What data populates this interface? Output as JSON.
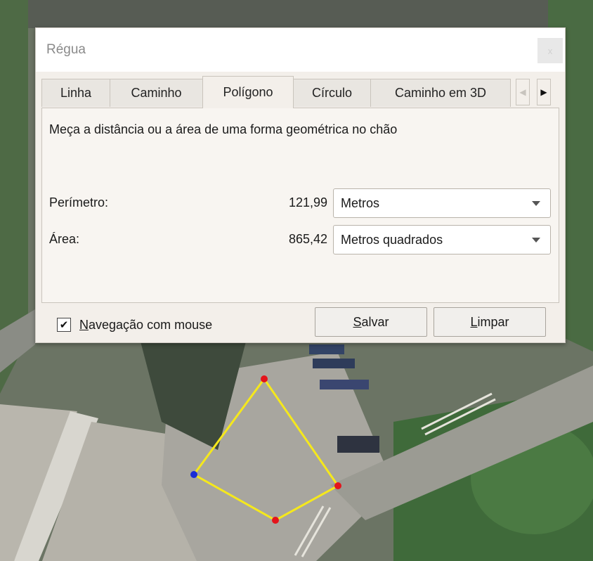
{
  "dialog": {
    "title": "Régua",
    "close_label": "x"
  },
  "tabs": [
    {
      "label": "Linha",
      "active": false
    },
    {
      "label": "Caminho",
      "active": false
    },
    {
      "label": "Polígono",
      "active": true
    },
    {
      "label": "Círculo",
      "active": false
    },
    {
      "label": "Caminho em 3D",
      "active": false
    }
  ],
  "tab_scroll": {
    "left_icon": "chevron-left-icon",
    "right_icon": "chevron-right-icon"
  },
  "panel": {
    "description": "Meça a distância ou a área de uma forma geométrica no chão",
    "perimeter": {
      "label": "Perímetro:",
      "value": "121,99",
      "unit": "Metros"
    },
    "area": {
      "label": "Área:",
      "value": "865,42",
      "unit": "Metros quadrados"
    }
  },
  "footer": {
    "mouse_nav": {
      "checked": true,
      "label_first": "N",
      "label_rest": "avegação com mouse"
    },
    "save": {
      "first": "S",
      "rest": "alvar"
    },
    "clear": {
      "first": "L",
      "rest": "impar"
    }
  },
  "map": {
    "polygon_color": "#f5e81c",
    "vertex_color": "#e4141b",
    "start_vertex_color": "#1a2ed6"
  }
}
